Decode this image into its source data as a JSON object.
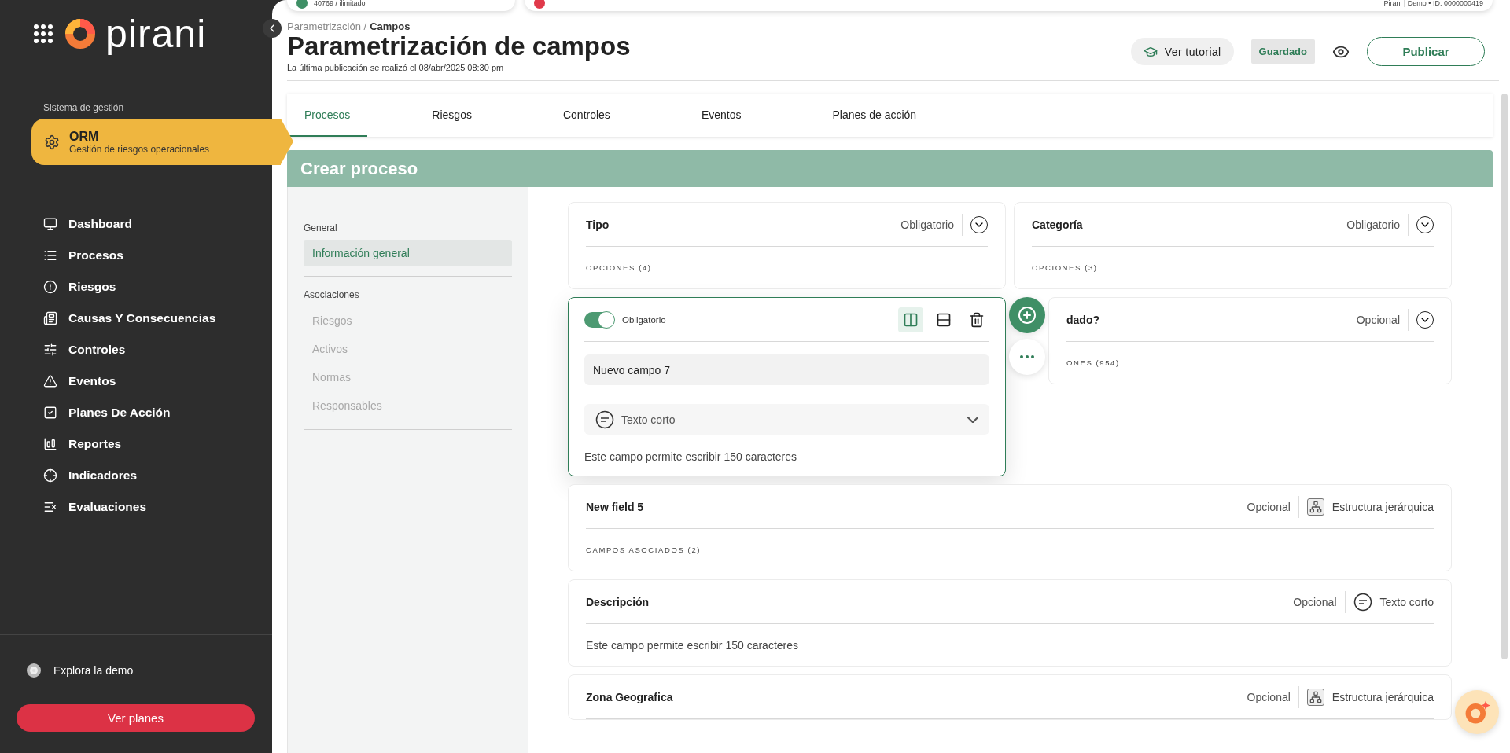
{
  "top_bar": {
    "plan_usage": "40769 / ilimitado",
    "account": "Pirani | Demo • ID: 0000000419"
  },
  "sidebar": {
    "brand": "pirani",
    "section_label": "Sistema de gestión",
    "module": {
      "title": "ORM",
      "subtitle": "Gestión de riesgos operacionales",
      "selected": true
    },
    "items": [
      {
        "label": "Dashboard"
      },
      {
        "label": "Procesos"
      },
      {
        "label": "Riesgos"
      },
      {
        "label": "Causas Y Consecuencias"
      },
      {
        "label": "Controles"
      },
      {
        "label": "Eventos"
      },
      {
        "label": "Planes De Acción"
      },
      {
        "label": "Reportes"
      },
      {
        "label": "Indicadores"
      },
      {
        "label": "Evaluaciones"
      }
    ],
    "demo_link": "Explora la demo",
    "plans_button": "Ver planes"
  },
  "header": {
    "breadcrumb_parent": "Parametrización /",
    "breadcrumb_current": "Campos",
    "title": "Parametrización de campos",
    "subtitle": "La última publicación se realizó el 08/abr/2025 08:30 pm",
    "tutorial_button": "Ver tutorial",
    "status": "Guardado",
    "publish_button": "Publicar"
  },
  "tabs": [
    {
      "label": "Procesos",
      "selected": true
    },
    {
      "label": "Riesgos",
      "selected": false
    },
    {
      "label": "Controles",
      "selected": false
    },
    {
      "label": "Eventos",
      "selected": false
    },
    {
      "label": "Planes de acción",
      "selected": false
    }
  ],
  "panel": {
    "title": "Crear proceso",
    "nav": [
      {
        "heading": "General",
        "items": [
          {
            "label": "Información general",
            "selected": true
          }
        ]
      },
      {
        "heading": "Asociaciones",
        "items": [
          {
            "label": "Riesgos",
            "selected": false
          },
          {
            "label": "Activos",
            "selected": false
          },
          {
            "label": "Normas",
            "selected": false
          },
          {
            "label": "Responsables",
            "selected": false
          }
        ]
      }
    ],
    "fields": [
      {
        "kind": "options",
        "full_width": false,
        "name": "Tipo",
        "requirement": "Obligatorio",
        "detail": "OPCIONES (4)"
      },
      {
        "kind": "options",
        "full_width": false,
        "name": "Categoría",
        "requirement": "Obligatorio",
        "detail": "OPCIONES (3)"
      },
      {
        "kind": "editor",
        "full_width": false,
        "required": true,
        "requirement": "Obligatorio",
        "name": "Nuevo campo 7",
        "type": "Texto corto",
        "detail": "Este campo permite escribir 150 caracteres"
      },
      {
        "kind": "options",
        "full_width": false,
        "name": "dado?",
        "requirement": "Opcional",
        "detail": "ONES (954)"
      },
      {
        "kind": "hierarchy",
        "full_width": true,
        "name": "New field 5",
        "requirement": "Opcional",
        "type": "Estructura jerárquica",
        "detail": "CAMPOS ASOCIADOS (2)"
      },
      {
        "kind": "text",
        "full_width": true,
        "name": "Descripción",
        "requirement": "Opcional",
        "type": "Texto corto",
        "detail": "Este campo permite escribir 150 caracteres"
      },
      {
        "kind": "hierarchy",
        "full_width": true,
        "name": "Zona Geografica",
        "requirement": "Opcional",
        "type": "Estructura jerárquica"
      }
    ]
  }
}
